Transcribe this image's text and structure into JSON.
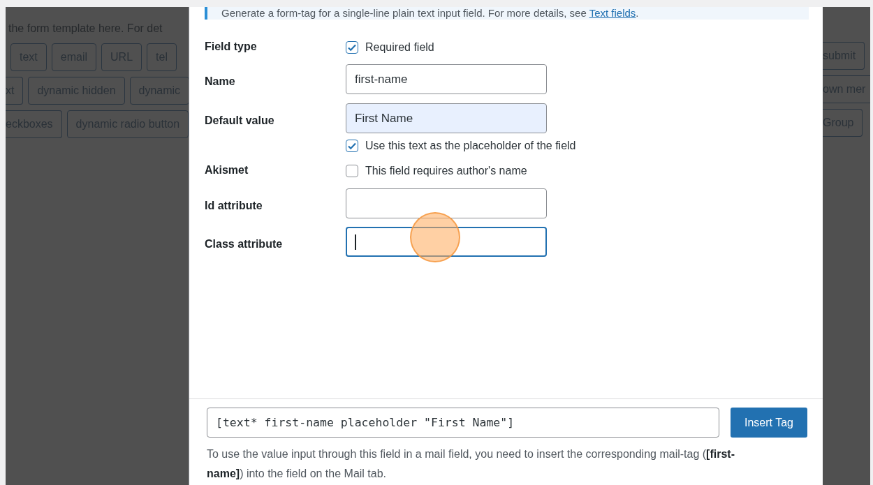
{
  "background": {
    "hint": "the form template here. For det",
    "left_rows": [
      [
        "text",
        "email",
        "URL",
        "tel"
      ],
      [
        "xt",
        "dynamic hidden",
        "dynamic"
      ],
      [
        "eckboxes",
        "dynamic radio button"
      ]
    ],
    "right_rows": [
      "submit",
      "own mer",
      "Group"
    ]
  },
  "dialog": {
    "notice": {
      "text": "Generate a form-tag for a single-line plain text input field. For more details, see ",
      "link": "Text fields",
      "end": "."
    },
    "fields": [
      {
        "label": "Field type",
        "kind": "checkbox",
        "options": [
          {
            "label": "Required field",
            "checked": true
          }
        ]
      },
      {
        "label": "Name",
        "kind": "input",
        "value": "first-name",
        "autofilled": false,
        "focused": false
      },
      {
        "label": "Default value",
        "kind": "input",
        "value": "First Name",
        "autofilled": true,
        "focused": false,
        "options": [
          {
            "label": "Use this text as the placeholder of the field",
            "checked": true
          }
        ]
      },
      {
        "label": "Akismet",
        "kind": "checkbox",
        "options": [
          {
            "label": "This field requires author's name",
            "checked": false
          }
        ]
      },
      {
        "label": "Id attribute",
        "kind": "input",
        "autofilled": false,
        "focused": false
      },
      {
        "label": "Class attribute",
        "kind": "input",
        "autofilled": false,
        "focused": true
      }
    ],
    "tag": "[text* first-name placeholder \"First Name\"]",
    "insert_button": "Insert Tag",
    "help": "To use the value input through this field in a mail field, you need to insert the corresponding mail-tag (**[first-name]**) into the field on the Mail tab."
  }
}
